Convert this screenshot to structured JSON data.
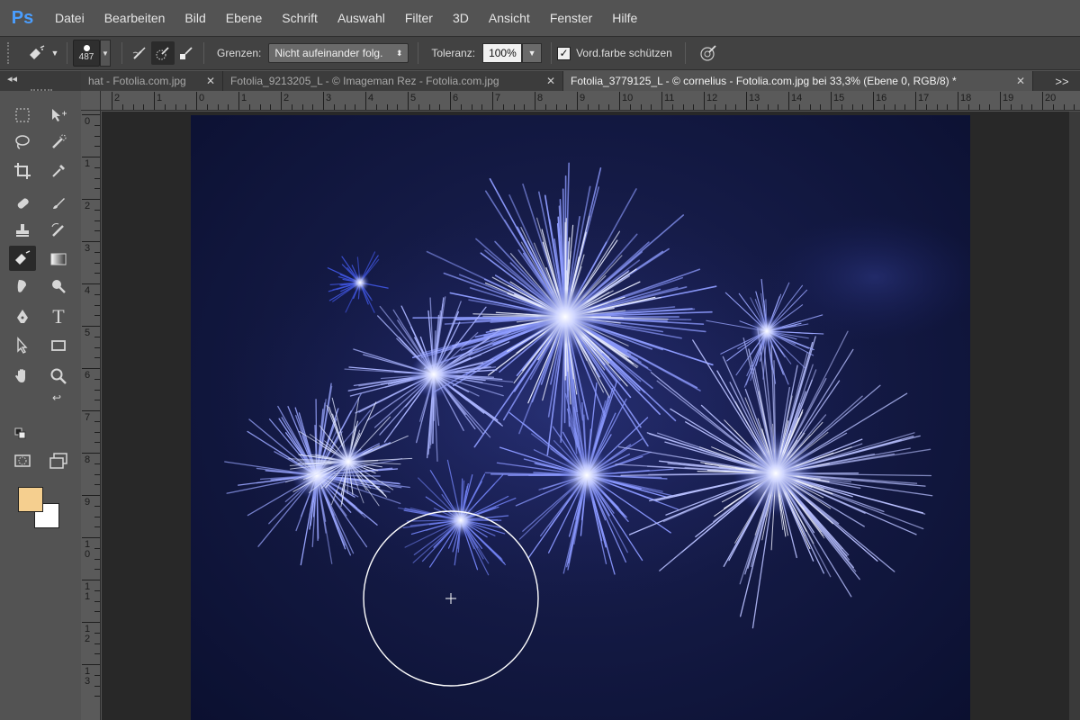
{
  "app": {
    "logo": "Ps"
  },
  "menu": [
    "Datei",
    "Bearbeiten",
    "Bild",
    "Ebene",
    "Schrift",
    "Auswahl",
    "Filter",
    "3D",
    "Ansicht",
    "Fenster",
    "Hilfe"
  ],
  "options": {
    "brush_size": "487",
    "limits_label": "Grenzen:",
    "limits_value": "Nicht aufeinander folg.",
    "tolerance_label": "Toleranz:",
    "tolerance_value": "100%",
    "protect_fg_label": "Vord.farbe schützen",
    "protect_fg_checked": true
  },
  "tabs": [
    {
      "label": "hat - Fotolia.com.jpg",
      "active": false
    },
    {
      "label": "Fotolia_9213205_L - © Imageman Rez - Fotolia.com.jpg",
      "active": false
    },
    {
      "label": "Fotolia_3779125_L - © cornelius - Fotolia.com.jpg bei 33,3% (Ebene 0, RGB/8) *",
      "active": true
    }
  ],
  "tab_overflow": ">>",
  "toolbox_collapse": "◂◂",
  "colors": {
    "foreground": "#f5cf8f",
    "background": "#ffffff",
    "accent": "#4a9eff"
  },
  "ruler_top": [
    "2",
    "1",
    "0",
    "1",
    "2",
    "3",
    "4",
    "5",
    "6",
    "7",
    "8",
    "9",
    "10",
    "11",
    "12",
    "13",
    "14",
    "15",
    "16",
    "17",
    "18",
    "19",
    "20"
  ],
  "ruler_left": [
    "0",
    "1",
    "2",
    "3",
    "4",
    "5",
    "6",
    "7",
    "8",
    "9",
    "10",
    "11",
    "12",
    "13"
  ],
  "tools": [
    "rectangular-marquee-icon",
    "move-icon",
    "lasso-icon",
    "quick-selection-icon",
    "crop-icon",
    "eyedropper-icon",
    "spot-healing-icon",
    "brush-icon",
    "clone-stamp-icon",
    "history-brush-icon",
    "background-eraser-icon",
    "gradient-icon",
    "smudge-icon",
    "dodge-icon",
    "pen-icon",
    "type-icon",
    "path-selection-icon",
    "rectangle-shape-icon",
    "hand-icon",
    "zoom-icon",
    "quick-mask-icon",
    "screen-mode-icon"
  ]
}
